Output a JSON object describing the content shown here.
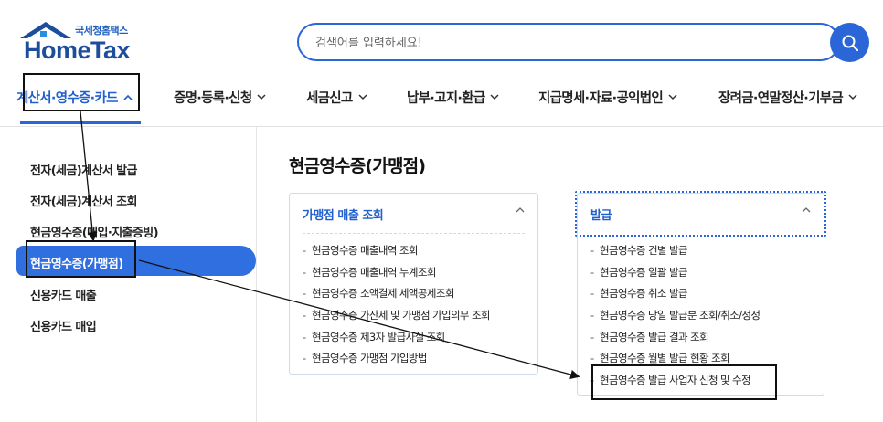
{
  "logo": {
    "sub_text": "국세청홈택스",
    "main_text": "HomeTax"
  },
  "search": {
    "placeholder": "검색어를 입력하세요!",
    "button_icon": "search-icon"
  },
  "nav": {
    "items": [
      {
        "label": "계산서·영수증·카드",
        "active": true
      },
      {
        "label": "증명·등록·신청"
      },
      {
        "label": "세금신고"
      },
      {
        "label": "납부·고지·환급"
      },
      {
        "label": "지급명세·자료·공익법인"
      },
      {
        "label": "장려금·연말정산·기부금"
      }
    ]
  },
  "sidebar": {
    "items": [
      {
        "label": "전자(세금)계산서 발급"
      },
      {
        "label": "전자(세금)계산서 조회"
      },
      {
        "label": "현금영수증(매입·지출증빙)"
      },
      {
        "label": "현금영수증(가맹점)",
        "active": true
      },
      {
        "label": "신용카드 매출"
      },
      {
        "label": "신용카드 매입"
      }
    ]
  },
  "main": {
    "title": "현금영수증(가맹점)",
    "panels": [
      {
        "heading": "가맹점 매출 조회",
        "items": [
          "현금영수증 매출내역 조회",
          "현금영수증 매출내역 누계조회",
          "현금영수증 소액결제 세액공제조회",
          "현금영수증 가산세 및 가맹점 가입의무 조회",
          "현금영수증 제3자 발급사실 조회",
          "현금영수증 가맹점 가입방법"
        ]
      },
      {
        "heading": "발급",
        "items": [
          "현금영수증 건별 발급",
          "현금영수증 일괄 발급",
          "현금영수증 취소 발급",
          "현금영수증 당일 발급분 조회/취소/정정",
          "현금영수증 발급 결과 조회",
          "현금영수증 월별 발급 현황 조회",
          "현금영수증 발급 사업자 신청 및 수정"
        ]
      }
    ]
  },
  "colors": {
    "accent": "#2a66d8",
    "active_sidebar_bg": "#2f6fe0",
    "logo_blue": "#1d4e9c"
  }
}
